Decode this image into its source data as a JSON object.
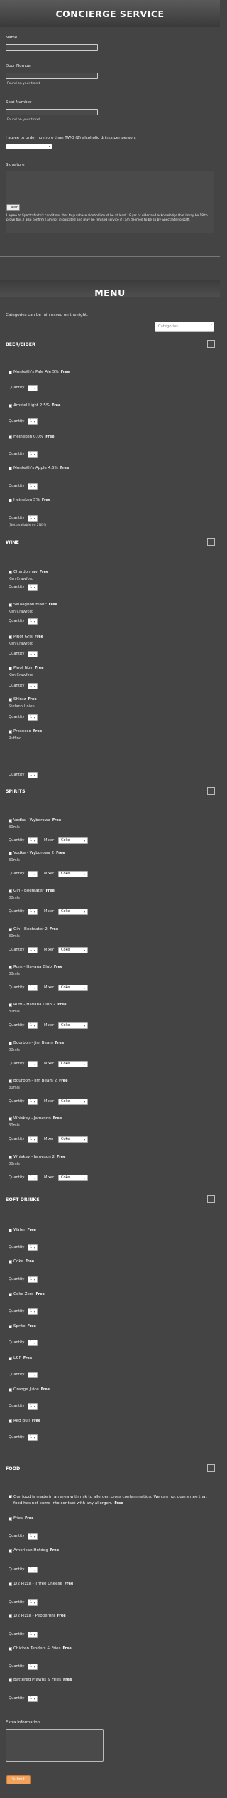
{
  "header": {
    "title": "CONCIERGE SERVICE"
  },
  "form": {
    "name_label": "Name",
    "door_label": "Door Number",
    "door_hint": "Found on your ticket",
    "seat_label": "Seat Number",
    "seat_hint": "Found on your ticket",
    "alcohol_note": "I agree to order no more than TWO (2) alcoholic drinks per person.",
    "signature_label": "Signature",
    "clear_label": "Clear",
    "agreement": "I agree to Spectrafinito's conditions that to purchase alcohol I must be at least 18 yrs or older and acknowledge that I may be 18 to prove this. I also confirm I am not intoxicated and may be refused service if I am deemed to be so by Spectrafinito staff."
  },
  "menu": {
    "title": "MENU",
    "intro": "Categories can be minimised on the right.",
    "category_placeholder": "Categories",
    "quantity_label": "Quantity",
    "quantity_value": "1",
    "free_label": "Free",
    "mixer_label": "Mixer",
    "mixer_value": "Coke",
    "categories": [
      {
        "name": "BEER/CIDER",
        "items": [
          {
            "name": "Monteith's Pale Ale 5%"
          },
          {
            "name": "Amstel Light 2.5%"
          },
          {
            "name": "Heineken 0.0%"
          },
          {
            "name": "Monteith's Apple 4.5%"
          },
          {
            "name": "Heineken 5%",
            "note": "(Not available on 2ND!)"
          }
        ]
      },
      {
        "name": "WINE",
        "items": [
          {
            "name": "Chardonnay",
            "sub": "Kim Crawford"
          },
          {
            "name": "Sauvignon Blanc",
            "sub": "Kim Crawford"
          },
          {
            "name": "Pinot Gris",
            "sub": "Kim Crawford"
          },
          {
            "name": "Pinot Noir",
            "sub": "Kim Crawford"
          },
          {
            "name": "Shiraz",
            "sub": "Stefano Union"
          },
          {
            "name": "Prosecco",
            "sub": "Ruffino"
          }
        ]
      },
      {
        "name": "SPIRITS",
        "items": [
          {
            "name": "Vodka - Wyborowa",
            "sub": "30mls"
          },
          {
            "name": "Vodka - Wyborowa 2",
            "sub": "30mls"
          },
          {
            "name": "Gin - Beefeater",
            "sub": "30mls"
          },
          {
            "name": "Gin - Beefeater 2",
            "sub": "30mls"
          },
          {
            "name": "Rum - Havana Club",
            "sub": "30mls"
          },
          {
            "name": "Rum - Havana Club 2",
            "sub": "30mls"
          },
          {
            "name": "Bourbon - Jim Beam",
            "sub": "30mls"
          },
          {
            "name": "Bourbon - Jim Beam 2",
            "sub": "30mls"
          },
          {
            "name": "Whiskey - Jameson",
            "sub": "30mls"
          },
          {
            "name": "Whiskey - Jameson 2",
            "sub": "30mls"
          }
        ]
      },
      {
        "name": "SOFT DRINKS",
        "items": [
          {
            "name": "Water"
          },
          {
            "name": "Coke"
          },
          {
            "name": "Coke Zero"
          },
          {
            "name": "Sprite"
          },
          {
            "name": "L&P"
          },
          {
            "name": "Orange Juice"
          },
          {
            "name": "Red Bull"
          }
        ]
      },
      {
        "name": "FOOD",
        "items": [
          {
            "name": "Our food is made in an area with risk to allergen cross contamination. We can not guarantee that food has not come into contact with any allergen."
          },
          {
            "name": "Fries"
          },
          {
            "name": "American Hotdog"
          },
          {
            "name": "1/2 Pizza - Three Cheese"
          },
          {
            "name": "1/2 Pizza - Pepperoni"
          },
          {
            "name": "Chicken Tenders & Fries"
          },
          {
            "name": "Battered Prawns & Fries"
          }
        ]
      }
    ]
  },
  "extra": {
    "label": "Extra Information.",
    "submit_label": "Submit"
  }
}
